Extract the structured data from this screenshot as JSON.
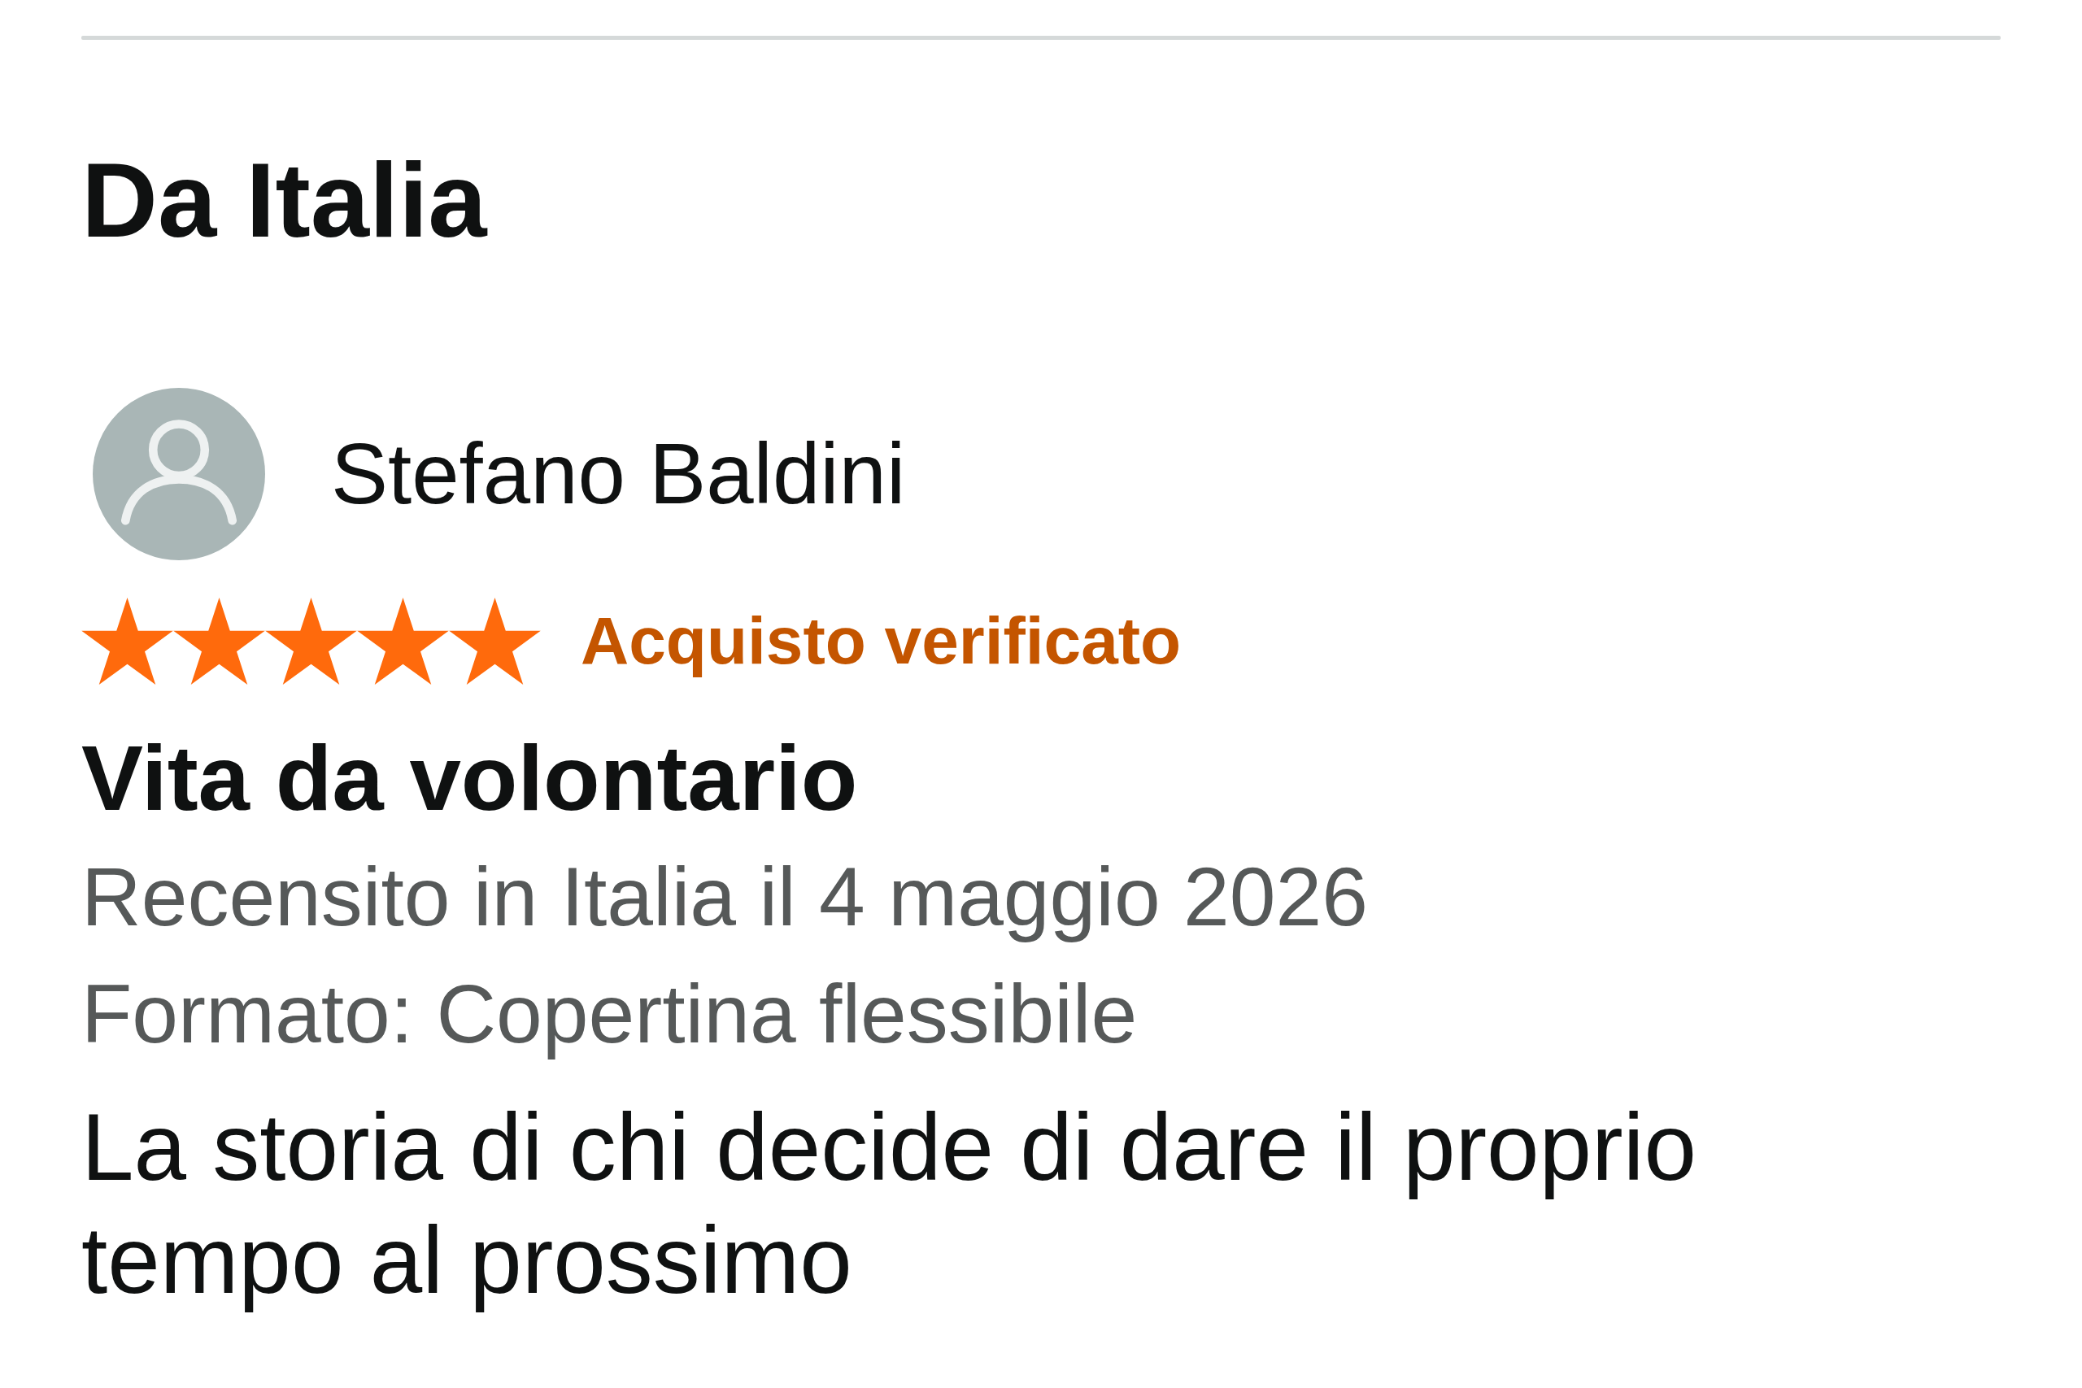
{
  "section": {
    "title": "Da Italia"
  },
  "review": {
    "author": {
      "name": "Stefano Baldini"
    },
    "stars": 5,
    "badge": "Acquisto verificato",
    "title": "Vita da volontario",
    "date": "Recensito in Italia il 4 maggio 2026",
    "format": "Formato: Copertina flessibile",
    "body": "La storia di chi decide di dare il proprio tempo al prossimo"
  }
}
